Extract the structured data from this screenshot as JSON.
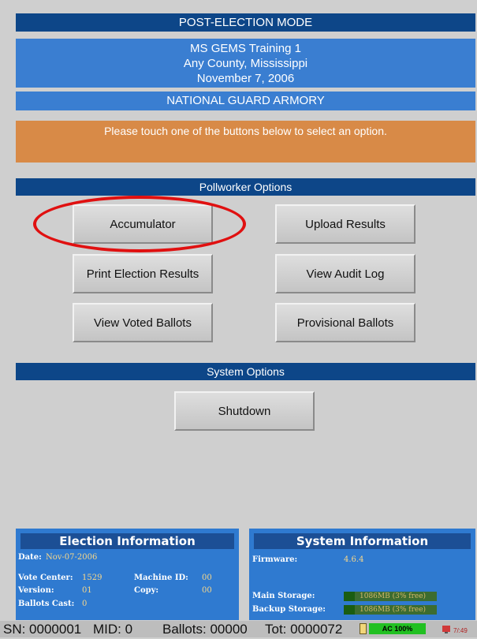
{
  "header": {
    "mode": "POST-ELECTION MODE",
    "election_name": "MS GEMS Training 1",
    "jurisdiction": "Any County, Mississippi",
    "election_date": "November 7, 2006",
    "location": "NATIONAL GUARD ARMORY"
  },
  "prompt": "Please touch one of the buttons below to select an option.",
  "pollworker": {
    "title": "Pollworker Options",
    "buttons": {
      "accumulator": "Accumulator",
      "upload_results": "Upload Results",
      "print_results": "Print Election Results",
      "view_audit_log": "View Audit Log",
      "view_voted_ballots": "View Voted Ballots",
      "provisional_ballots": "Provisional Ballots"
    }
  },
  "system": {
    "title": "System Options",
    "shutdown": "Shutdown"
  },
  "election_info": {
    "title": "Election Information",
    "date_label": "Date:",
    "date_value": "Nov-07-2006",
    "vote_center_label": "Vote Center:",
    "vote_center_value": "1529",
    "machine_id_label": "Machine ID:",
    "machine_id_value": "00",
    "version_label": "Version:",
    "version_value": "01",
    "copy_label": "Copy:",
    "copy_value": "00",
    "ballots_cast_label": "Ballots Cast:",
    "ballots_cast_value": "0"
  },
  "system_info": {
    "title": "System Information",
    "firmware_label": "Firmware:",
    "firmware_value": "4.6.4",
    "main_storage_label": "Main Storage:",
    "main_storage_value": "1086MB (3% free)",
    "backup_storage_label": "Backup Storage:",
    "backup_storage_value": "1086MB (3% free)"
  },
  "status_bar": {
    "sn": "SN: 0000001",
    "mid": "MID: 0",
    "ballots": "Ballots: 00000",
    "tot": "Tot: 0000072",
    "power": "AC 100%",
    "clock": "7/:49"
  },
  "colors": {
    "navy": "#0d4688",
    "blue": "#3a7ed1",
    "orange": "#d88a47",
    "highlight": "#e01010"
  }
}
